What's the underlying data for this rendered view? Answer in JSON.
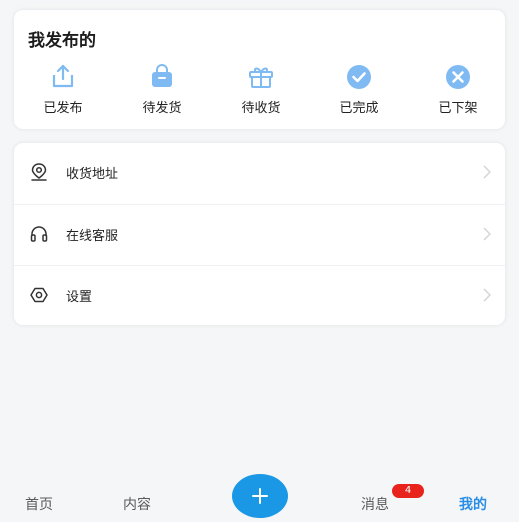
{
  "publish_card": {
    "title": "我发布的",
    "items": [
      {
        "label": "已发布",
        "icon": "upload-icon"
      },
      {
        "label": "待发货",
        "icon": "bag-icon"
      },
      {
        "label": "待收货",
        "icon": "gift-icon"
      },
      {
        "label": "已完成",
        "icon": "check-circle-icon"
      },
      {
        "label": "已下架",
        "icon": "x-circle-icon"
      }
    ]
  },
  "menu": {
    "items": [
      {
        "label": "收货地址",
        "icon": "location-icon"
      },
      {
        "label": "在线客服",
        "icon": "headset-icon"
      },
      {
        "label": "设置",
        "icon": "settings-icon"
      }
    ]
  },
  "tabbar": {
    "home_label": "首页",
    "content_label": "内容",
    "messages_label": "消息",
    "messages_badge": "4",
    "mine_label": "我的",
    "active_tab": "我的"
  },
  "colors": {
    "accent": "#2a8de6",
    "icon_blue": "#7fbaf2",
    "fab_blue": "#1a98e6",
    "badge_red": "#e8231c"
  }
}
